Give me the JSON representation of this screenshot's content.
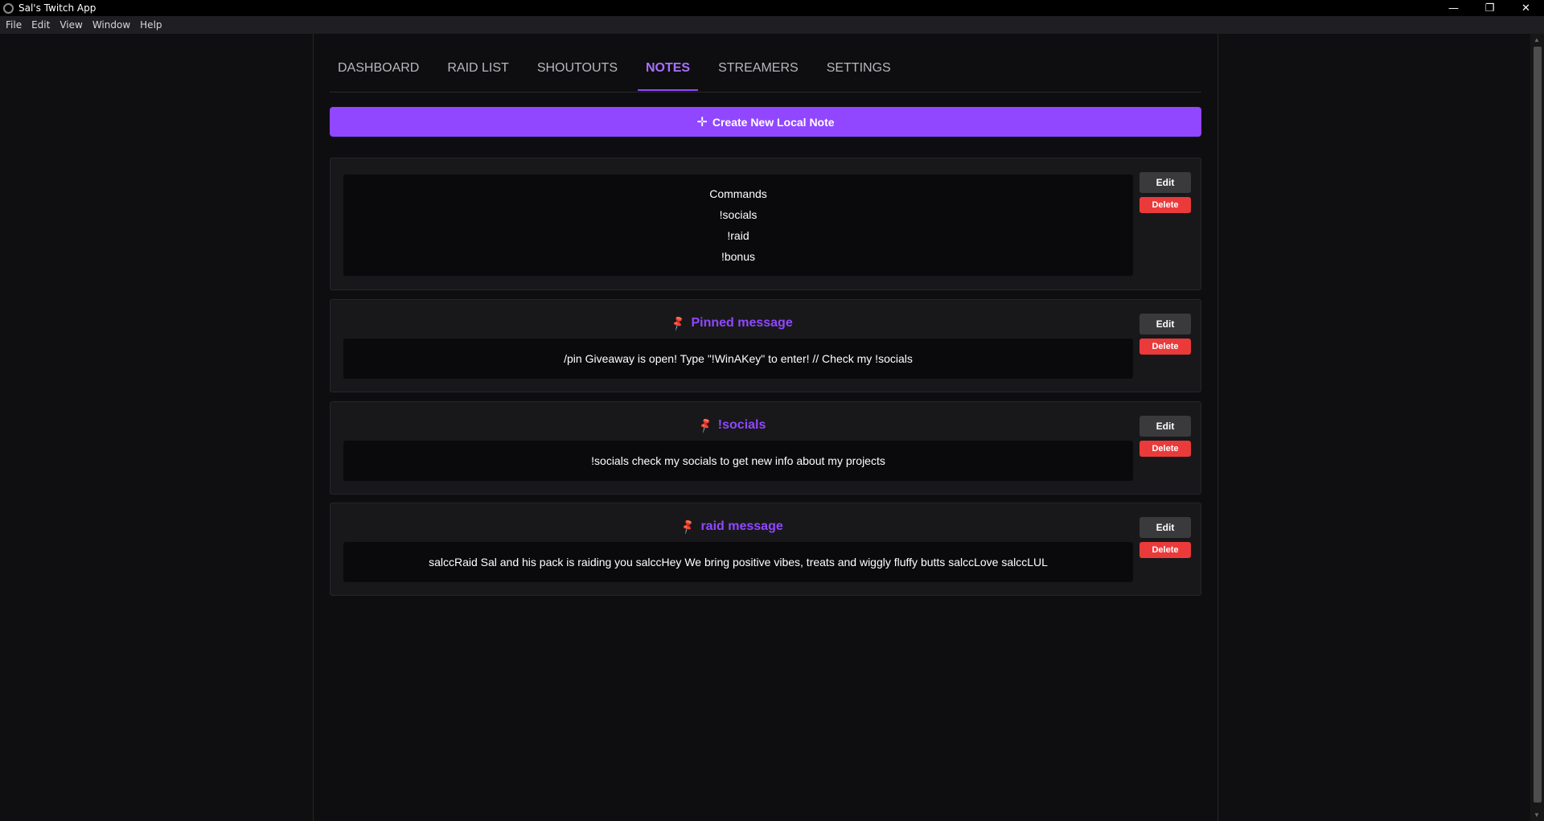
{
  "window": {
    "title": "Sal's Twitch App",
    "minimize": "—",
    "restore": "❐",
    "close": "✕"
  },
  "menu": [
    "File",
    "Edit",
    "View",
    "Window",
    "Help"
  ],
  "tabs": [
    {
      "label": "DASHBOARD"
    },
    {
      "label": "RAID LIST"
    },
    {
      "label": "SHOUTOUTS"
    },
    {
      "label": "NOTES",
      "active": true
    },
    {
      "label": "STREAMERS"
    },
    {
      "label": "SETTINGS"
    }
  ],
  "create_button": {
    "icon": "plus-icon",
    "label": "Create New Local Note"
  },
  "notes": [
    {
      "title": "",
      "pinned": false,
      "lines": [
        "Commands",
        "!socials",
        "!raid",
        "!bonus"
      ],
      "edit_label": "Edit",
      "delete_label": "Delete"
    },
    {
      "title": "Pinned message",
      "pinned": true,
      "lines": [
        "/pin Giveaway is open! Type \"!WinAKey\" to enter! // Check my !socials"
      ],
      "edit_label": "Edit",
      "delete_label": "Delete"
    },
    {
      "title": "!socials",
      "pinned": true,
      "lines": [
        "!socials check my socials to get new info about my projects"
      ],
      "edit_label": "Edit",
      "delete_label": "Delete"
    },
    {
      "title": "raid message",
      "pinned": true,
      "lines": [
        "salccRaid Sal and his pack is raiding you salccHey We bring positive vibes, treats and wiggly fluffy butts salccLove salccLUL"
      ],
      "edit_label": "Edit",
      "delete_label": "Delete"
    }
  ],
  "colors": {
    "accent": "#9147ff",
    "delete": "#eb3a3a",
    "pin": "#e24a2c"
  }
}
